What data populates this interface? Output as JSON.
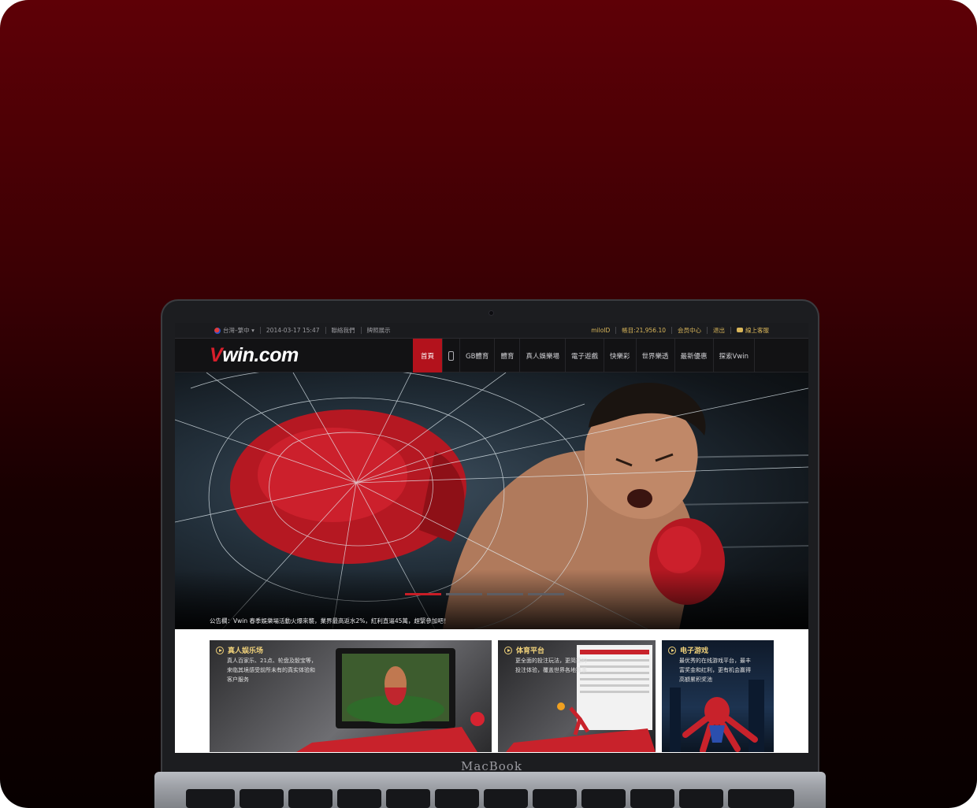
{
  "laptop": {
    "brand": "MacBook"
  },
  "topbar": {
    "region": "台灣–繁中 ▾",
    "datetime": "2014-03-17 15:47",
    "contact": "聯絡我們",
    "license": "牌照展示",
    "username": "miloID",
    "balance": "帳目:21,956.10",
    "member_center": "会员中心",
    "logout": "退出",
    "live_support": "線上客服"
  },
  "navbar": {
    "logo_v": "V",
    "logo_rest": "win.com",
    "items": [
      "首頁",
      "GB體育",
      "體育",
      "真人娛樂場",
      "電子遊戲",
      "快樂彩",
      "世界樂透",
      "最新優惠",
      "探索Vwin"
    ]
  },
  "hero": {
    "notice": "公告欄：Vwin 春季娛樂場活動火爆來襲，業界最高返水2%，紅利直逼45萬，趕緊參加吧！",
    "slides": 4,
    "active_slide": 1
  },
  "panels": [
    {
      "title": "真人娱乐场",
      "lines": [
        "真人百家乐、21点、轮盘及骰宝等，",
        "来临其境感受前所未有的真实体验和",
        "客户服务"
      ]
    },
    {
      "title": "体育平台",
      "lines": [
        "更全面的投注玩法，更简捷的",
        "投注体验，覆盖世界各地赛事"
      ]
    },
    {
      "title": "电子游戏",
      "lines": [
        "最优秀的在线游戏平台，最丰",
        "富奖金和红利，更有机会赢得",
        "高額累积奖池"
      ]
    }
  ],
  "colors": {
    "accent_red": "#b3121c",
    "logo_red": "#d81e2b",
    "gold": "#d9b65a",
    "panel_title": "#f1d27a"
  }
}
